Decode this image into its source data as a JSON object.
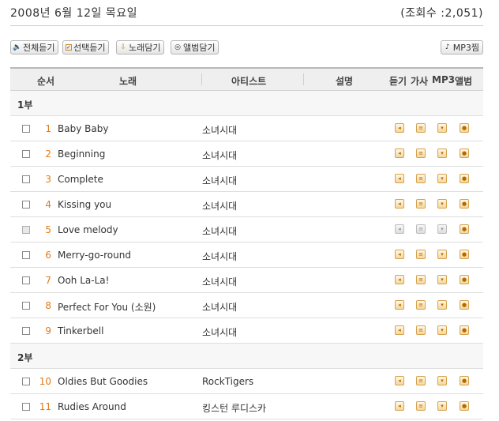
{
  "header": {
    "date": "2008년 6월 12일 목요일",
    "views": "(조회수 :2,051)"
  },
  "toolbar": {
    "play_all": "전체듣기",
    "play_selected": "선택듣기",
    "add_songs": "노래담기",
    "add_album": "앨범담기",
    "mp3_keep": "MP3찜"
  },
  "columns": {
    "order": "순서",
    "song": "노래",
    "artist": "아티스트",
    "desc": "설명",
    "listen": "듣기",
    "lyrics": "가사",
    "mp3": "MP3",
    "album": "앨범"
  },
  "groups": [
    {
      "label": "1부"
    },
    {
      "label": "2부"
    }
  ],
  "tracks": [
    {
      "num": "1",
      "title": "Baby Baby",
      "artist": "소녀시대"
    },
    {
      "num": "2",
      "title": "Beginning",
      "artist": "소녀시대"
    },
    {
      "num": "3",
      "title": "Complete",
      "artist": "소녀시대"
    },
    {
      "num": "4",
      "title": "Kissing you",
      "artist": "소녀시대"
    },
    {
      "num": "5",
      "title": "Love melody",
      "artist": "소녀시대"
    },
    {
      "num": "6",
      "title": "Merry-go-round",
      "artist": "소녀시대"
    },
    {
      "num": "7",
      "title": "Ooh La-La!",
      "artist": "소녀시대"
    },
    {
      "num": "8",
      "title": "Perfect For You (소원)",
      "artist": "소녀시대"
    },
    {
      "num": "9",
      "title": "Tinkerbell",
      "artist": "소녀시대"
    },
    {
      "num": "10",
      "title": "Oldies But Goodies",
      "artist": "RockTigers"
    },
    {
      "num": "11",
      "title": "Rudies Around",
      "artist": "킹스턴 루디스카"
    }
  ],
  "icons": {
    "listen": "speaker-icon",
    "lyrics": "lyrics-doc-icon",
    "mp3": "download-icon",
    "album": "album-disc-icon"
  },
  "colors": {
    "number": "#e27a17",
    "icon_border": "#d7a24f"
  }
}
